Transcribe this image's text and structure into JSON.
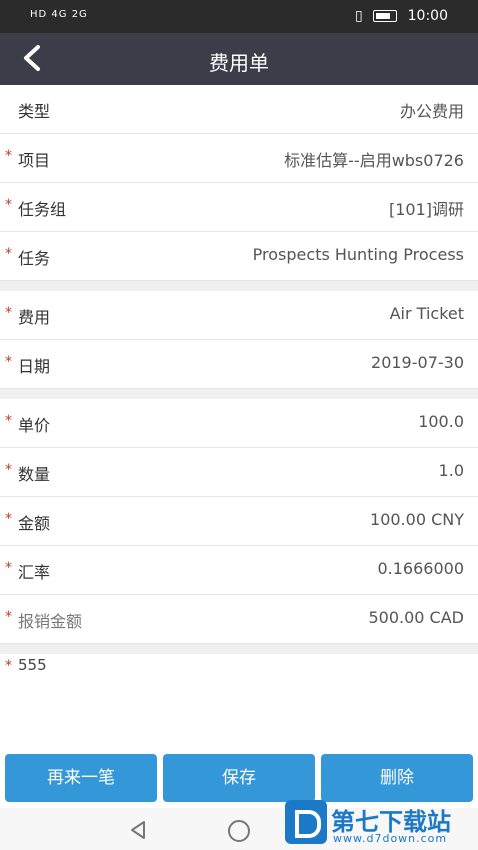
{
  "status": {
    "left": "HD 4G 2G",
    "time": "10:00"
  },
  "header": {
    "title": "费用单"
  },
  "fields": [
    {
      "label": "类型",
      "value": "办公费用",
      "required": false
    },
    {
      "label": "项目",
      "value": "标准估算--启用wbs0726",
      "required": true
    },
    {
      "label": "任务组",
      "value": "[101]调研",
      "required": true
    },
    {
      "label": "任务",
      "value": "Prospects Hunting Process",
      "required": true
    }
  ],
  "fields2": [
    {
      "label": "费用",
      "value": "Air Ticket",
      "required": true
    },
    {
      "label": "日期",
      "value": "2019-07-30",
      "required": true
    }
  ],
  "fields3": [
    {
      "label": "单价",
      "value": "100.0",
      "required": true
    },
    {
      "label": "数量",
      "value": "1.0",
      "required": true
    },
    {
      "label": "金额",
      "value": "100.00   CNY",
      "required": true
    },
    {
      "label": "汇率",
      "value": "0.1666000",
      "required": true
    },
    {
      "label": "报销金额",
      "value": "500.00   CAD",
      "required": true
    }
  ],
  "note": {
    "text": "555"
  },
  "buttons": {
    "again": "再来一笔",
    "save": "保存",
    "delete": "删除"
  },
  "watermark": {
    "name": "第七下载站",
    "url": "www.d7down.com"
  },
  "colors": {
    "header": "#3b3d48",
    "button": "#3497d8",
    "required": "#c0392b"
  }
}
